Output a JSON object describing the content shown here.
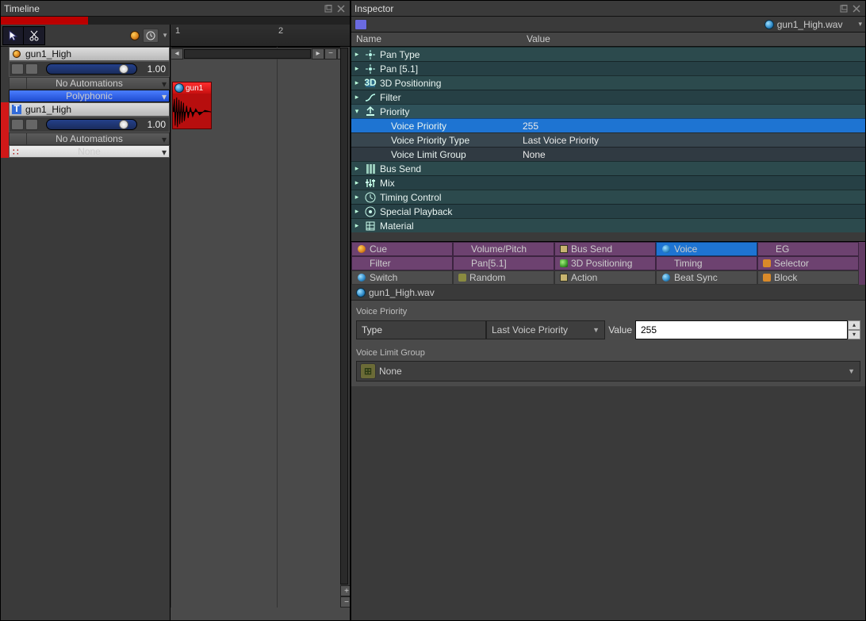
{
  "timeline": {
    "title": "Timeline",
    "ruler": {
      "marks": [
        "1",
        "2"
      ]
    },
    "tracks": [
      {
        "accent": "#d98a1a",
        "name": "gun1_High",
        "slider_value": "1.00",
        "automations_label": "No Automations",
        "mode_label": "Polyphonic",
        "mode_style": "poly",
        "icon": "orange-dot"
      },
      {
        "accent": "#d11818",
        "name": "gun1_High",
        "slider_value": "1.00",
        "automations_label": "No Automations",
        "mode_label": "None",
        "mode_style": "none",
        "icon": "text-icon"
      }
    ],
    "clip": {
      "label": "gun1"
    }
  },
  "inspector": {
    "title": "Inspector",
    "filename": "gun1_High.wav",
    "columns": {
      "name": "Name",
      "value": "Value"
    },
    "tree": [
      {
        "kind": "top",
        "label": "Pan Type",
        "icon": "pan"
      },
      {
        "kind": "top",
        "label": "Pan [5.1]",
        "icon": "pan"
      },
      {
        "kind": "top",
        "label": "3D Positioning",
        "icon": "3d"
      },
      {
        "kind": "top",
        "label": "Filter",
        "icon": "filter"
      },
      {
        "kind": "expanded",
        "label": "Priority",
        "icon": "priority"
      },
      {
        "kind": "sub",
        "indent": 2,
        "label": "Voice Priority",
        "value": "255",
        "selected": true
      },
      {
        "kind": "sub",
        "indent": 2,
        "label": "Voice Priority Type",
        "value": "Last Voice Priority"
      },
      {
        "kind": "sub",
        "indent": 2,
        "label": "Voice Limit Group",
        "value": "None"
      },
      {
        "kind": "top",
        "label": "Bus Send",
        "icon": "bus"
      },
      {
        "kind": "top",
        "label": "Mix",
        "icon": "mix"
      },
      {
        "kind": "top",
        "label": "Timing Control",
        "icon": "timing"
      },
      {
        "kind": "top",
        "label": "Special Playback",
        "icon": "special"
      },
      {
        "kind": "top",
        "label": "Material",
        "icon": "material"
      }
    ],
    "tabs": [
      [
        {
          "label": "Cue",
          "icon": "orange"
        },
        {
          "label": "Volume/Pitch",
          "icon": ""
        },
        {
          "label": "Bus Send",
          "icon": "square"
        },
        {
          "label": "Voice",
          "icon": "blue",
          "active": true
        },
        {
          "label": "EG",
          "icon": ""
        }
      ],
      [
        {
          "label": "Filter",
          "icon": ""
        },
        {
          "label": "Pan[5.1]",
          "icon": ""
        },
        {
          "label": "3D Positioning",
          "icon": "green"
        },
        {
          "label": "Timing",
          "icon": ""
        },
        {
          "label": "Selector",
          "icon": "orange2"
        }
      ],
      [
        {
          "label": "Switch",
          "disabled": true,
          "icon": "blue"
        },
        {
          "label": "Random",
          "disabled": true,
          "icon": "olive"
        },
        {
          "label": "Action",
          "disabled": true,
          "icon": "square"
        },
        {
          "label": "Beat Sync",
          "disabled": true,
          "icon": "blue"
        },
        {
          "label": "Block",
          "disabled": true,
          "icon": "orange2"
        }
      ]
    ],
    "form": {
      "priority_section": "Voice Priority",
      "type_label": "Type",
      "type_value": "Last Voice Priority",
      "value_label": "Value",
      "value_value": "255",
      "group_section": "Voice Limit Group",
      "group_value": "None"
    }
  }
}
